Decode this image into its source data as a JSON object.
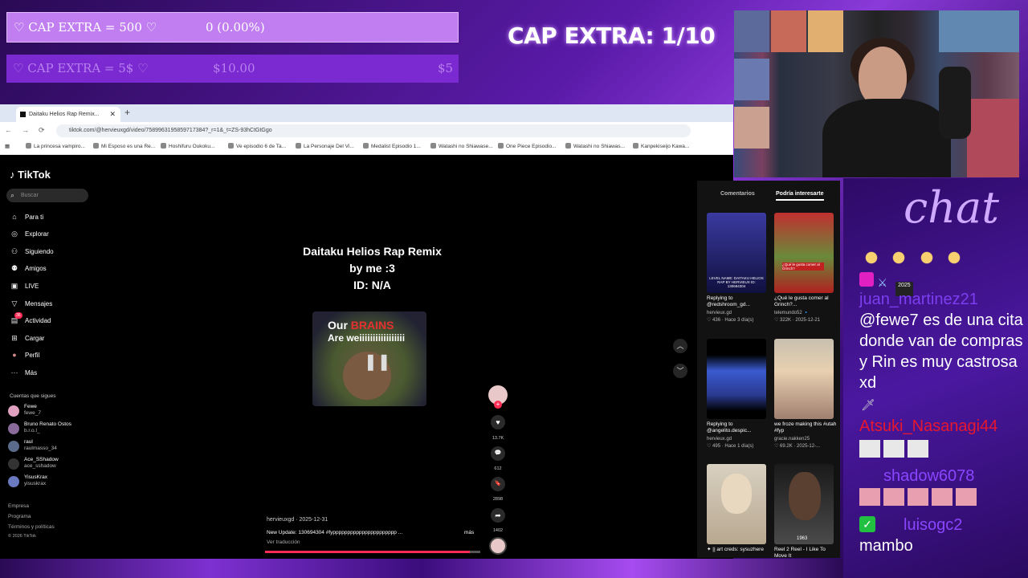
{
  "overlay": {
    "cap_bar1_label": "♡ CAP EXTRA = 500 ♡",
    "cap_bar1_value": "0 (0.00%)",
    "cap_bar2_label": "♡ CAP EXTRA = 5$ ♡",
    "cap_bar2_value": "$10.00",
    "cap_bar2_goal": "$5",
    "big_cap": "CAP EXTRA: 1/10"
  },
  "browser": {
    "tab_title": "Daitaku Helios Rap Remix...",
    "tab_close": "✕",
    "new_tab": "+",
    "url": "tiktok.com/@hervieuxgd/video/7589963195859717384?_r=1&_t=ZS-93hCtGtGgo",
    "bookmarks": [
      "La princesa vampiro...",
      "Mi Esposo es una Re...",
      "Hoshifuru Oukoku...",
      "Ve episodio 6 de Ta...",
      "La Personaje Del Vi...",
      "Medalist Episodio 1...",
      "Watashi no Shiawase...",
      "One Piece Episodio...",
      "Watashi no Shiawas...",
      "Kanpekiseijo Kawa..."
    ]
  },
  "tiktok": {
    "logo": "TikTok",
    "search_placeholder": "Buscar",
    "nav": [
      {
        "label": "Para ti",
        "icon": "⌂"
      },
      {
        "label": "Explorar",
        "icon": "◎"
      },
      {
        "label": "Siguiendo",
        "icon": "⚇"
      },
      {
        "label": "Amigos",
        "icon": "⚉"
      },
      {
        "label": "LIVE",
        "icon": "▣"
      },
      {
        "label": "Mensajes",
        "icon": "▽"
      },
      {
        "label": "Actividad",
        "icon": "▤"
      },
      {
        "label": "Cargar",
        "icon": "⊞"
      },
      {
        "label": "Perfil",
        "icon": "●"
      },
      {
        "label": "Más",
        "icon": "···"
      }
    ],
    "activity_badge": "36",
    "following_header": "Cuentas que sigues",
    "following": [
      {
        "name": "Fewe",
        "handle": "fewe_7"
      },
      {
        "name": "Bruno Renato Ostos",
        "handle": "b.r.o.l_"
      },
      {
        "name": "raul",
        "handle": "raulmasso_34"
      },
      {
        "name": "Ace_SShadow",
        "handle": "ace_sshadow"
      },
      {
        "name": "YisusKrax",
        "handle": "yisuskrax"
      }
    ],
    "footer": [
      "Empresa",
      "Programa",
      "Términos y políticas",
      "© 2026 TikTok"
    ],
    "video": {
      "title_lines": [
        "Daitaku Helios Rap Remix",
        "by me :3",
        "ID: N/A"
      ],
      "overlay_line1_white": "Our",
      "overlay_line1_red": "BRAINS",
      "overlay_line2": "Are weiiiiiiiiiiiiiiiii",
      "author": "hervieuxgd · 2025-12-31",
      "description": "New Update: 130694304 #fypppppppppppppppppppppp ...",
      "more": "más",
      "translate": "Ver traducción",
      "progress": 0.95
    },
    "actions": [
      {
        "icon": "♥",
        "count": "13.7K"
      },
      {
        "icon": "💬",
        "count": "612"
      },
      {
        "icon": "🔖",
        "count": "2898"
      },
      {
        "icon": "➦",
        "count": "1402"
      }
    ],
    "follow_plus": "+",
    "side_tabs": [
      "Comentarios",
      "Podría interesarte"
    ],
    "suggestions": [
      {
        "caption": "Replying to @redshroom_gd...",
        "author": "hervieux.gd",
        "meta": "♡ 436 · Hace 3 día(s)"
      },
      {
        "caption": "¿Qué le gusta comer al Grinch?...",
        "author": "telemundo52 🔹",
        "meta": "♡ 322K · 2025-12-21"
      },
      {
        "caption": "Replying to @angelito.despic...",
        "author": "hervieux.gd",
        "meta": "♡ 495 · Hace 1 día(s)"
      },
      {
        "caption": "we froze making this #utah #fyp",
        "author": "gracie.nakken25",
        "meta": "♡ 69.2K · 2025-12-..."
      },
      {
        "caption": "✦ || art creds: sysuzhere",
        "author": "",
        "meta": ""
      },
      {
        "caption": "Reel 2 Reel - I Like To Move It",
        "author": "",
        "meta": ""
      }
    ],
    "thumb_texts": [
      "LEVEL NAME: DAITAKU HELIOS RAP BY HERVIEUX ID: 130694304",
      "¿Qué le gusta comer al Grinch?",
      "",
      "",
      "",
      "1963"
    ]
  },
  "chat": {
    "title": "chat",
    "messages": [
      {
        "user": "",
        "text": "",
        "color": "#ffffff"
      },
      {
        "user": "juan_martinez21",
        "text": "@fewe7 es de una cita donde van de compras y Rin es muy castrosa xd",
        "color": "#7c3ef0"
      },
      {
        "user": "Atsuki_Nasanagi44",
        "text": "",
        "color": "#e8162e"
      },
      {
        "user": "shadow6078",
        "text": "",
        "color": "#8a46ff"
      },
      {
        "user": "luisogc2",
        "text": "mambo",
        "color": "#8a46ff"
      }
    ],
    "badge_num": "2025"
  },
  "colors": {
    "tiktok_red": "#fe2c55",
    "cap_bar1": "#c07ef0",
    "cap_bar2": "#7a2ad0",
    "chat_bg": "#3a1288"
  }
}
